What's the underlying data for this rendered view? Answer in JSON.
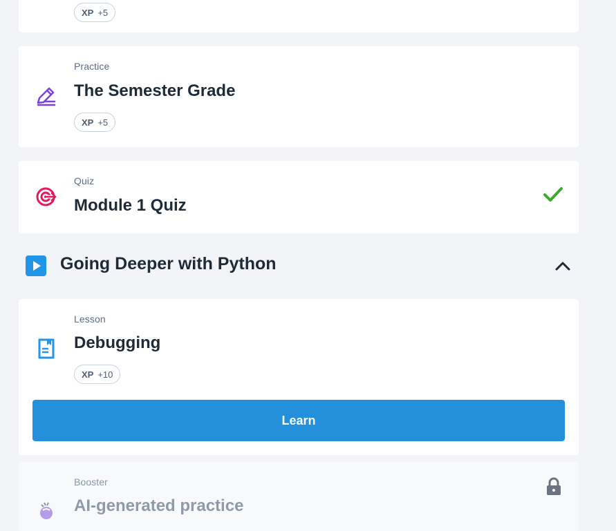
{
  "cards": {
    "top": {
      "xp_label": "XP",
      "xp_value": "+5"
    },
    "practice": {
      "type": "Practice",
      "title": "The Semester Grade",
      "xp_label": "XP",
      "xp_value": "+5",
      "icon": "pencil-icon"
    },
    "quiz": {
      "type": "Quiz",
      "title": "Module 1 Quiz",
      "icon": "target-icon",
      "status_icon": "checkmark-icon"
    },
    "lesson": {
      "type": "Lesson",
      "title": "Debugging",
      "xp_label": "XP",
      "xp_value": "+10",
      "icon": "document-icon",
      "button_label": "Learn"
    },
    "booster": {
      "type": "Booster",
      "title": "AI-generated practice",
      "icon": "brain-icon",
      "status_icon": "lock-icon"
    }
  },
  "section": {
    "title": "Going Deeper with Python",
    "icon": "play-icon",
    "toggle_icon": "chevron-up-icon"
  },
  "colors": {
    "page_background": "#f2f4f7",
    "card_background": "#ffffff",
    "primary_blue": "#2490dc",
    "practice_purple": "#7b3fe4",
    "quiz_pink": "#e3185d",
    "lesson_blue": "#2196e8",
    "success_green": "#3ea82f"
  }
}
